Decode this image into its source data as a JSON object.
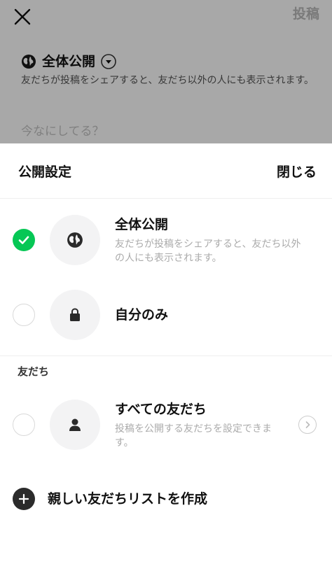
{
  "composer": {
    "post_label": "投稿",
    "privacy_label": "全体公開",
    "privacy_description": "友だちが投稿をシェアすると、友だち以外の人にも表示されます。",
    "placeholder": "今なにしてる？"
  },
  "sheet": {
    "title": "公開設定",
    "close_label": "閉じる",
    "options": [
      {
        "title": "全体公開",
        "description": "友だちが投稿をシェアすると、友だち以外の人にも表示されます。",
        "icon": "globe-icon",
        "selected": true
      },
      {
        "title": "自分のみ",
        "icon": "lock-icon",
        "selected": false
      }
    ],
    "friends_section": {
      "label": "友だち",
      "option": {
        "title": "すべての友だち",
        "description": "投稿を公開する友だちを設定できます。",
        "icon": "person-icon",
        "selected": false
      }
    },
    "create_list_label": "親しい友だちリストを作成"
  },
  "colors": {
    "accent_green": "#06c755",
    "overlay": "rgba(0,0,0,0.34)"
  }
}
